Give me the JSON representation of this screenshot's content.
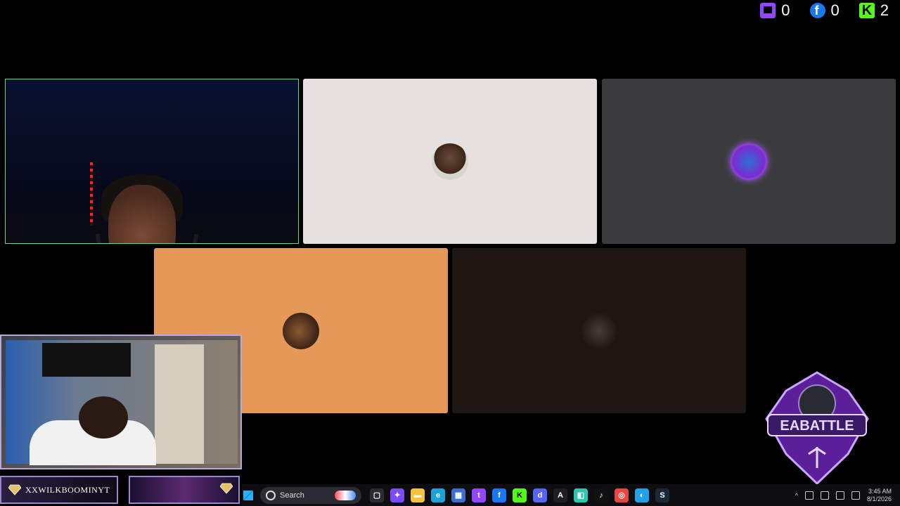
{
  "counters": [
    {
      "platform": "twitch-icon",
      "value": "0",
      "color": "#9146ff"
    },
    {
      "platform": "facebook-icon",
      "value": "0",
      "color": "#1877f2"
    },
    {
      "platform": "kick-icon",
      "value": "2",
      "color": "#53fc18"
    }
  ],
  "tiles": [
    {
      "name": "participant-tile-1"
    },
    {
      "name": "participant-tile-2"
    },
    {
      "name": "participant-tile-3"
    },
    {
      "name": "participant-tile-4"
    },
    {
      "name": "participant-tile-5"
    }
  ],
  "nameplate": {
    "label": "XXWILKBOOMINYT"
  },
  "logo": {
    "text": "EABATTLE"
  },
  "taskbar": {
    "search_label": "Search",
    "apps": [
      {
        "icon": "task-view-icon",
        "color": "#2b2b33",
        "glyph": "▢"
      },
      {
        "icon": "copilot-icon",
        "color": "#7a4cff",
        "glyph": "✦"
      },
      {
        "icon": "file-explorer-icon",
        "color": "#f4c33a",
        "glyph": "▬"
      },
      {
        "icon": "edge-icon",
        "color": "#1aa3d8",
        "glyph": "e"
      },
      {
        "icon": "store-icon",
        "color": "#3a6fd0",
        "glyph": "▦"
      },
      {
        "icon": "twitch-icon",
        "color": "#9146ff",
        "glyph": "t"
      },
      {
        "icon": "facebook-icon",
        "color": "#1877f2",
        "glyph": "f"
      },
      {
        "icon": "kick-icon",
        "color": "#53fc18",
        "glyph": "K"
      },
      {
        "icon": "discord-icon",
        "color": "#5865f2",
        "glyph": "d"
      },
      {
        "icon": "app-a-icon",
        "color": "#1f1f1f",
        "glyph": "A"
      },
      {
        "icon": "app-teal-icon",
        "color": "#2bc7b0",
        "glyph": "◧"
      },
      {
        "icon": "tiktok-live-icon",
        "color": "#111111",
        "glyph": "♪"
      },
      {
        "icon": "chrome-icon",
        "color": "#e8453c",
        "glyph": "◎"
      },
      {
        "icon": "browser-icon",
        "color": "#1fa2e8",
        "glyph": "◐"
      },
      {
        "icon": "steam-icon",
        "color": "#1b2838",
        "glyph": "S"
      }
    ],
    "time": "3:45 AM",
    "date": "8/1/2026"
  }
}
